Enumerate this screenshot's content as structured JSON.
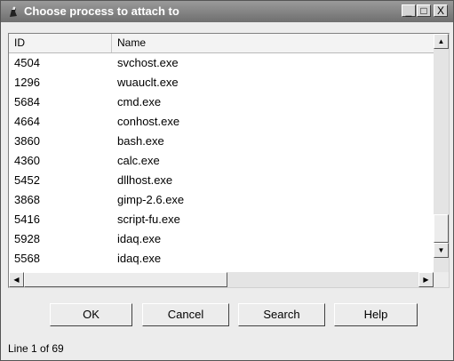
{
  "window": {
    "title": "Choose process to attach to",
    "minimize": "_",
    "maximize": "□",
    "close": "X"
  },
  "table": {
    "columns": [
      "ID",
      "Name"
    ],
    "rows": [
      {
        "id": "4504",
        "name": "svchost.exe"
      },
      {
        "id": "1296",
        "name": "wuauclt.exe"
      },
      {
        "id": "5684",
        "name": "cmd.exe"
      },
      {
        "id": "4664",
        "name": "conhost.exe"
      },
      {
        "id": "3860",
        "name": "bash.exe"
      },
      {
        "id": "4360",
        "name": "calc.exe"
      },
      {
        "id": "5452",
        "name": "dllhost.exe"
      },
      {
        "id": "3868",
        "name": "gimp-2.6.exe"
      },
      {
        "id": "5416",
        "name": "script-fu.exe"
      },
      {
        "id": "5928",
        "name": "idaq.exe"
      },
      {
        "id": "5568",
        "name": "idaq.exe"
      }
    ]
  },
  "scrollbars": {
    "up": "▲",
    "down": "▼",
    "left": "◀",
    "right": "▶"
  },
  "buttons": {
    "ok": "OK",
    "cancel": "Cancel",
    "search": "Search",
    "help": "Help"
  },
  "status": "Line 1 of 69"
}
